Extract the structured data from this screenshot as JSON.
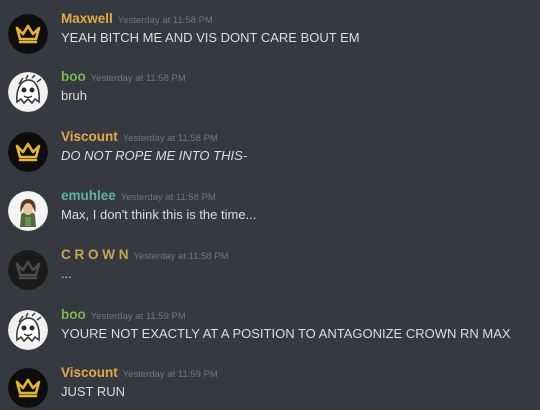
{
  "colors": {
    "background": "#36393f",
    "gold_author": "#e2a84a",
    "green_author": "#79b550",
    "teal_author": "#5fb59a",
    "crown_author": "#c9a74f",
    "message_text": "#dcddde",
    "timestamp": "#72767d"
  },
  "messages": [
    {
      "author": "Maxwell",
      "timestamp": "Yesterday at 11:58 PM",
      "text": "YEAH BITCH ME AND VIS DONT CARE BOUT EM",
      "avatar": "gold-crown-avatar"
    },
    {
      "author": "boo",
      "timestamp": "Yesterday at 11:58 PM",
      "text": "bruh",
      "avatar": "ghost-sketch-avatar"
    },
    {
      "author": "Viscount",
      "timestamp": "Yesterday at 11:58 PM",
      "text": "DO NOT ROPE ME INTO THIS-",
      "avatar": "gold-crown-avatar"
    },
    {
      "author": "emuhlee",
      "timestamp": "Yesterday at 11:58 PM",
      "text": "Max, I don't think this is the time...",
      "avatar": "girl-portrait-avatar"
    },
    {
      "author": "C R O W N",
      "timestamp": "Yesterday at 11:58 PM",
      "text": "...",
      "avatar": "dark-crown-avatar"
    },
    {
      "author": "boo",
      "timestamp": "Yesterday at 11:59 PM",
      "text": "YOURE NOT EXACTLY AT A POSITION TO ANTAGONIZE CROWN RN MAX",
      "avatar": "ghost-sketch-avatar"
    },
    {
      "author": "Viscount",
      "timestamp": "Yesterday at 11:59 PM",
      "text": "JUST RUN",
      "avatar": "gold-crown-avatar"
    }
  ]
}
